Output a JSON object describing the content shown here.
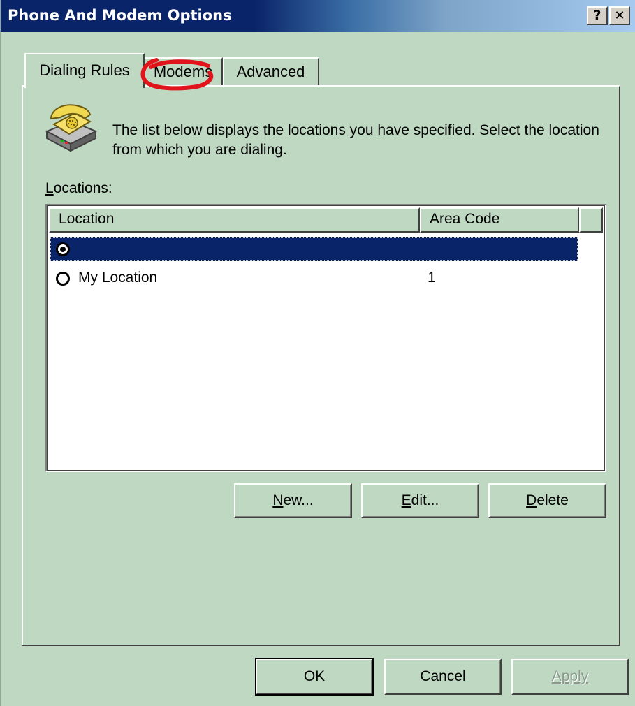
{
  "window": {
    "title": "Phone And Modem Options",
    "help_glyph": "?",
    "close_glyph": "✕"
  },
  "tabs": [
    {
      "label": "Dialing Rules",
      "active": true
    },
    {
      "label": "Modems",
      "active": false
    },
    {
      "label": "Advanced",
      "active": false
    }
  ],
  "dialing_rules": {
    "description": "The list below displays the locations you have specified. Select the location from which you are dialing.",
    "locations_label": "Locations:",
    "columns": [
      "Location",
      "Area Code"
    ],
    "rows": [
      {
        "location": "",
        "area_code": "",
        "selected": true
      },
      {
        "location": "My Location",
        "area_code": "1",
        "selected": false
      }
    ],
    "buttons": {
      "new": {
        "accel": "N",
        "rest": "ew..."
      },
      "edit": {
        "accel": "E",
        "rest": "dit..."
      },
      "delete": {
        "accel": "D",
        "rest": "elete"
      }
    }
  },
  "dialog_buttons": {
    "ok": "OK",
    "cancel": "Cancel",
    "apply": "Apply"
  },
  "colors": {
    "face": "#bed8c1",
    "titlebar": "#0a246a",
    "selection": "#0a246a",
    "annotation": "#e0141a"
  },
  "icons": [
    "phone-icon",
    "help-icon",
    "close-icon",
    "radio-selected-icon",
    "radio-unselected-icon"
  ]
}
